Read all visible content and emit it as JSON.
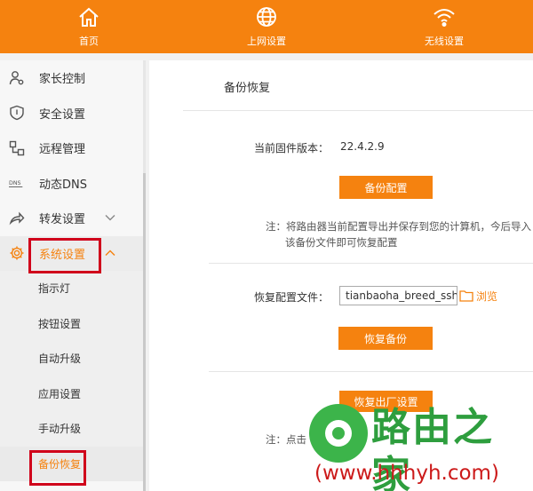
{
  "topnav": {
    "items": [
      {
        "label": "首页",
        "icon": "home-icon"
      },
      {
        "label": "上网设置",
        "icon": "globe-icon"
      },
      {
        "label": "无线设置",
        "icon": "wifi-icon"
      }
    ]
  },
  "sidebar": {
    "items": [
      {
        "label": "家长控制",
        "icon": "parent-control-icon"
      },
      {
        "label": "安全设置",
        "icon": "shield-icon"
      },
      {
        "label": "远程管理",
        "icon": "remote-icon"
      },
      {
        "label": "动态DNS",
        "icon": "dns-icon"
      },
      {
        "label": "转发设置",
        "icon": "forward-icon"
      },
      {
        "label": "系统设置",
        "icon": "gear-icon"
      }
    ],
    "subitems": [
      "指示灯",
      "按钮设置",
      "自动升级",
      "应用设置",
      "手动升级",
      "备份恢复"
    ]
  },
  "main": {
    "title": "备份恢复",
    "firmware_label": "当前固件版本：",
    "firmware_value": "22.4.2.9",
    "backup_button": "备份配置",
    "note1": "注：将路由器当前配置导出并保存到您的计算机，今后导入该备份文件即可恢复配置",
    "restore_label": "恢复配置文件：",
    "file_value": "tianbaoha_breed_ssh",
    "browse_label": "浏览",
    "restore_button": "恢复备份",
    "factory_button": "恢复出厂设置",
    "note2": "注：点击"
  },
  "watermark": {
    "title": "路由之家",
    "url": "(www.hhhyh.com)"
  },
  "colors": {
    "accent": "#f5820f",
    "highlight": "#d0021b"
  }
}
